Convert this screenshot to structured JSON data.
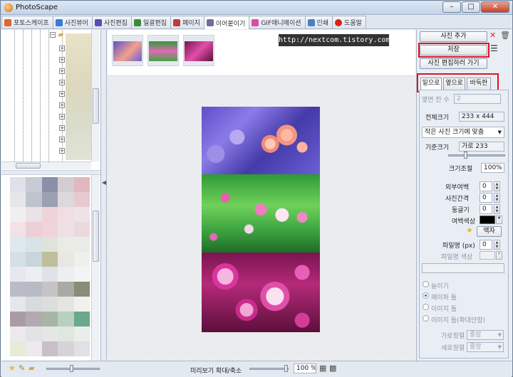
{
  "window": {
    "title": "PhotoScape",
    "minimize": "–",
    "maximize": "□",
    "close": "✕"
  },
  "tabs": [
    {
      "label": "포토스케이프",
      "color": "#e0662a"
    },
    {
      "label": "사진뷰어",
      "color": "#3a7bd5"
    },
    {
      "label": "사진편집",
      "color": "#5b4ab8"
    },
    {
      "label": "일괄편집",
      "color": "#3b8a3b"
    },
    {
      "label": "페이지",
      "color": "#c23b3b"
    },
    {
      "label": "이어붙이기",
      "color": "#6e6e9a"
    },
    {
      "label": "GIF애니메이션",
      "color": "#d94fa0"
    },
    {
      "label": "인쇄",
      "color": "#4f7fbf"
    },
    {
      "label": "도움말",
      "color": "#d9201c"
    }
  ],
  "watermark": "http://nextcom.tistory.com",
  "right_panel": {
    "add_photo": "사진 추가",
    "save": "저장",
    "go_edit": "사진 편집하러 가기",
    "direction_tabs": [
      "밑으로",
      "옆으로",
      "바둑판"
    ],
    "column_count_label": "옆면 칸 수",
    "column_count_value": "2",
    "total_size_label": "전체크기",
    "total_size_value": "233 x 444",
    "fit_option": "작은 사진 크기에 맞춤",
    "base_size_label": "기준크기",
    "base_size_value": "가로 233",
    "resize_label": "크기조절",
    "resize_value": "100%",
    "outer_margin_label": "외부여백",
    "outer_margin_value": "0",
    "gap_label": "사진간격",
    "gap_value": "0",
    "round_label": "둥글기",
    "round_value": "0",
    "margin_color_label": "여백색상",
    "margin_color": "#000000",
    "frame_button": "액자",
    "filename_label": "파일명 (px)",
    "filename_value": "0",
    "filename_color_label": "파일명 색상",
    "radio_options": [
      "늘이기",
      "페이퍼 틀",
      "이미지 틀",
      "이미지 틀(확대안함)"
    ],
    "radio_selected": 1,
    "horizontal_align_label": "가로정렬",
    "horizontal_align_value": "중앙",
    "vertical_align_label": "세로정렬",
    "vertical_align_value": "중앙"
  },
  "status": {
    "preview_zoom_label": "미리보기 확대/축소",
    "zoom_value": "100 %"
  },
  "icons": [
    "app-icon",
    "delete-x-icon",
    "trash-icon",
    "menu-icon",
    "star-icon",
    "folder-icon",
    "grid-view-icon"
  ]
}
